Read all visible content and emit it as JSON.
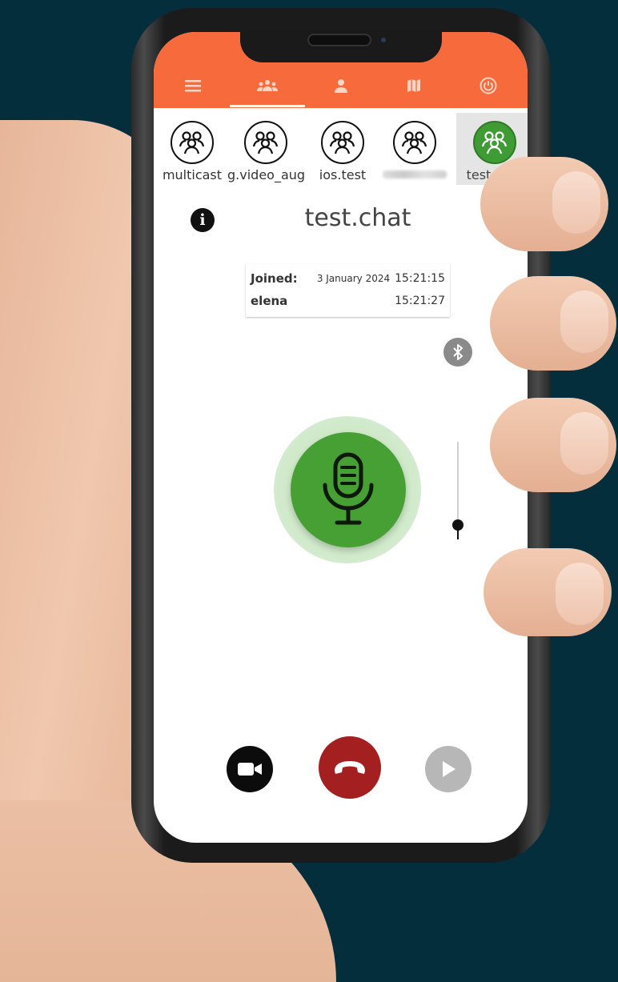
{
  "nav": {
    "icons": [
      "menu-icon",
      "group-icon",
      "person-icon",
      "map-icon",
      "power-icon"
    ],
    "active_tab": "group"
  },
  "channels": [
    {
      "label": "multicast",
      "active": false
    },
    {
      "label": "g.video_aug",
      "active": false
    },
    {
      "label": "ios.test",
      "active": false
    },
    {
      "label": "",
      "active": false
    },
    {
      "label": "test.chat",
      "active": true
    }
  ],
  "channel_title": "test.chat",
  "joined": {
    "label": "Joined:",
    "date": "3 January 2024",
    "time": "15:21:15",
    "members": [
      {
        "name": "elena",
        "time": "15:21:27"
      }
    ]
  },
  "volume_level": 0.15,
  "colors": {
    "brand": "#f76a3c",
    "mic_active": "#46a034",
    "hangup": "#a41f1f"
  }
}
